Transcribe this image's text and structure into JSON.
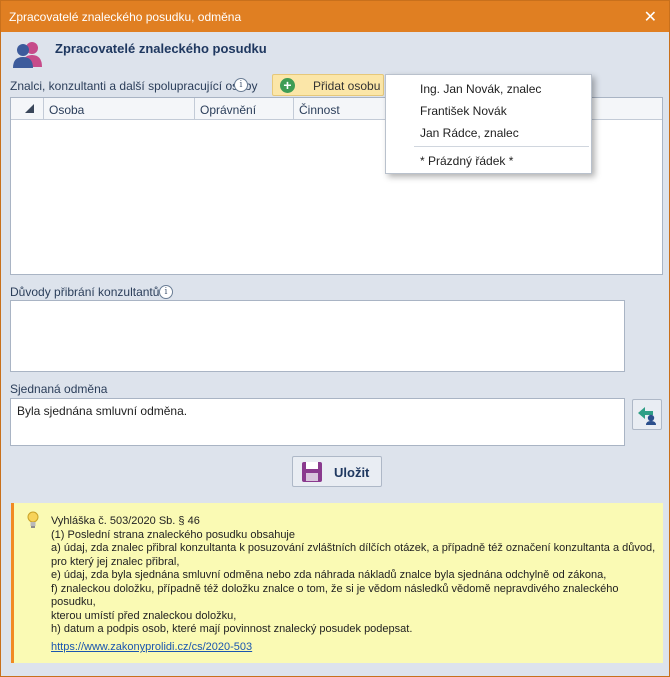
{
  "window": {
    "title": "Zpracovatelé znaleckého posudku, odměna",
    "close_glyph": "✕"
  },
  "header": {
    "title": "Zpracovatelé znaleckého posudku",
    "icon": "users-icon"
  },
  "experts": {
    "label": "Znalci, konzultanti a další spolupracující osoby",
    "info_glyph": "i",
    "add_button": "Přidat osobu",
    "columns": [
      "Osoba",
      "Oprávnění",
      "Činnost"
    ],
    "rows": []
  },
  "dropdown": {
    "items": [
      "Ing. Jan Novák, znalec",
      "František Novák",
      "Jan Rádce, znalec"
    ],
    "empty_row": "* Prázdný řádek *"
  },
  "reasons": {
    "label": "Důvody přibrání konzultantů",
    "info_glyph": "i",
    "value": ""
  },
  "reward": {
    "label": "Sjednaná odměna",
    "value": "Byla sjednána smluvní odměna."
  },
  "save_button": "Uložit",
  "notice": {
    "lines": [
      "Vyhláška č. 503/2020 Sb. § 46",
      "(1) Poslední strana znaleckého posudku obsahuje",
      "a) údaj, zda znalec přibral konzultanta k posuzování zvláštních dílčích otázek, a případně též označení konzultanta a důvod,",
      "pro který jej znalec přibral,",
      "e) údaj, zda byla sjednána smluvní odměna nebo zda náhrada nákladů znalce byla sjednána odchylně od zákona,",
      "f) znaleckou doložku, případně též doložku znalce o tom, že si je vědom následků vědomě nepravdivého znaleckého posudku,",
      "kterou umístí před znaleckou doložku,",
      "h) datum a podpis osob, které mají povinnost znalecký posudek podepsat."
    ],
    "link": "https://www.zakonyprolidi.cz/cs/2020-503"
  },
  "colors": {
    "titlebar": "#e07f22",
    "background": "#dde3ec",
    "notice_background": "#fafab4",
    "notice_border": "#f18a22",
    "add_button": "#fbe6a8",
    "header_text": "#1f3860"
  }
}
